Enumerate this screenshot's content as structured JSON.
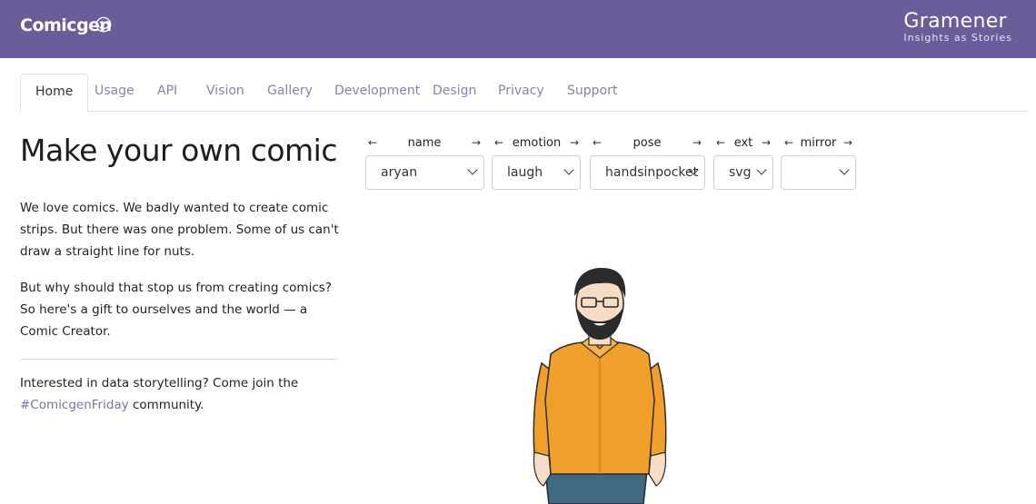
{
  "header": {
    "brand": "Comicgen",
    "smile": "☺",
    "logo_name": "Gramener",
    "logo_tagline": "Insights as Stories"
  },
  "tabs": [
    {
      "label": "Home",
      "active": true
    },
    {
      "label": "Usage"
    },
    {
      "label": "API"
    },
    {
      "label": "Vision"
    },
    {
      "label": "Gallery"
    },
    {
      "label": "Development"
    },
    {
      "label": "Design"
    },
    {
      "label": "Privacy"
    },
    {
      "label": "Support"
    }
  ],
  "main": {
    "heading": "Make your own comic",
    "para1": "We love comics. We badly wanted to create comic strips. But there was one problem. Some of us can't draw a straight line for nuts.",
    "para2": "But why should that stop us from creating comics? So here's a gift to ourselves and the world — a Comic Creator.",
    "para3_prefix": "Interested in data storytelling? Come join the ",
    "para3_link": "#ComicgenFriday",
    "para3_suffix": " community."
  },
  "controls": {
    "prev": "←",
    "next": "→",
    "fields": [
      {
        "label": "name",
        "value": "aryan"
      },
      {
        "label": "emotion",
        "value": "laugh"
      },
      {
        "label": "pose",
        "value": "handsinpocket"
      },
      {
        "label": "ext",
        "value": "svg"
      },
      {
        "label": "mirror",
        "value": ""
      }
    ]
  },
  "colors": {
    "header_bg": "#6a5d9a",
    "link": "#7a6fa8",
    "shirt": "#f0a02a",
    "jeans": "#3e6a82"
  }
}
